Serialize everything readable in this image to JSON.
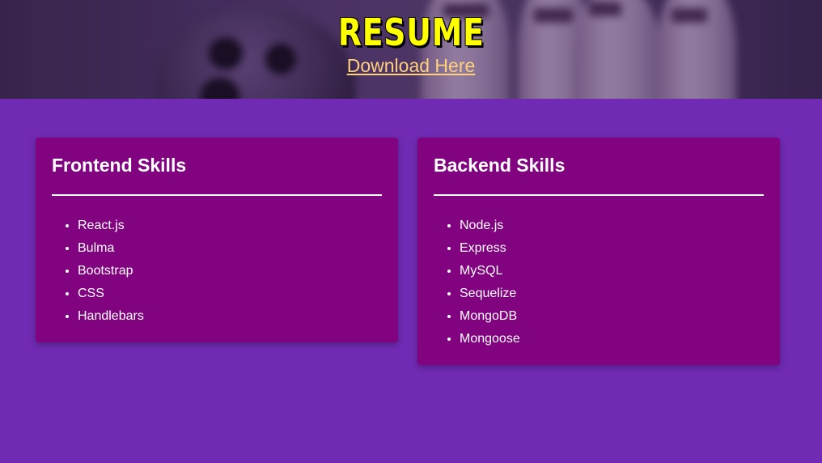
{
  "header": {
    "title": "RESUME",
    "download_link": "Download Here"
  },
  "cards": [
    {
      "title": "Frontend Skills",
      "items": [
        "React.js",
        "Bulma",
        "Bootstrap",
        "CSS",
        "Handlebars"
      ]
    },
    {
      "title": "Backend Skills",
      "items": [
        "Node.js",
        "Express",
        "MySQL",
        "Sequelize",
        "MongoDB",
        "Mongoose"
      ]
    }
  ],
  "colors": {
    "page_background": "#702ab3",
    "card_background": "#820380",
    "title": "#ffff00",
    "link": "#ffd27a",
    "text": "#ffffff"
  }
}
